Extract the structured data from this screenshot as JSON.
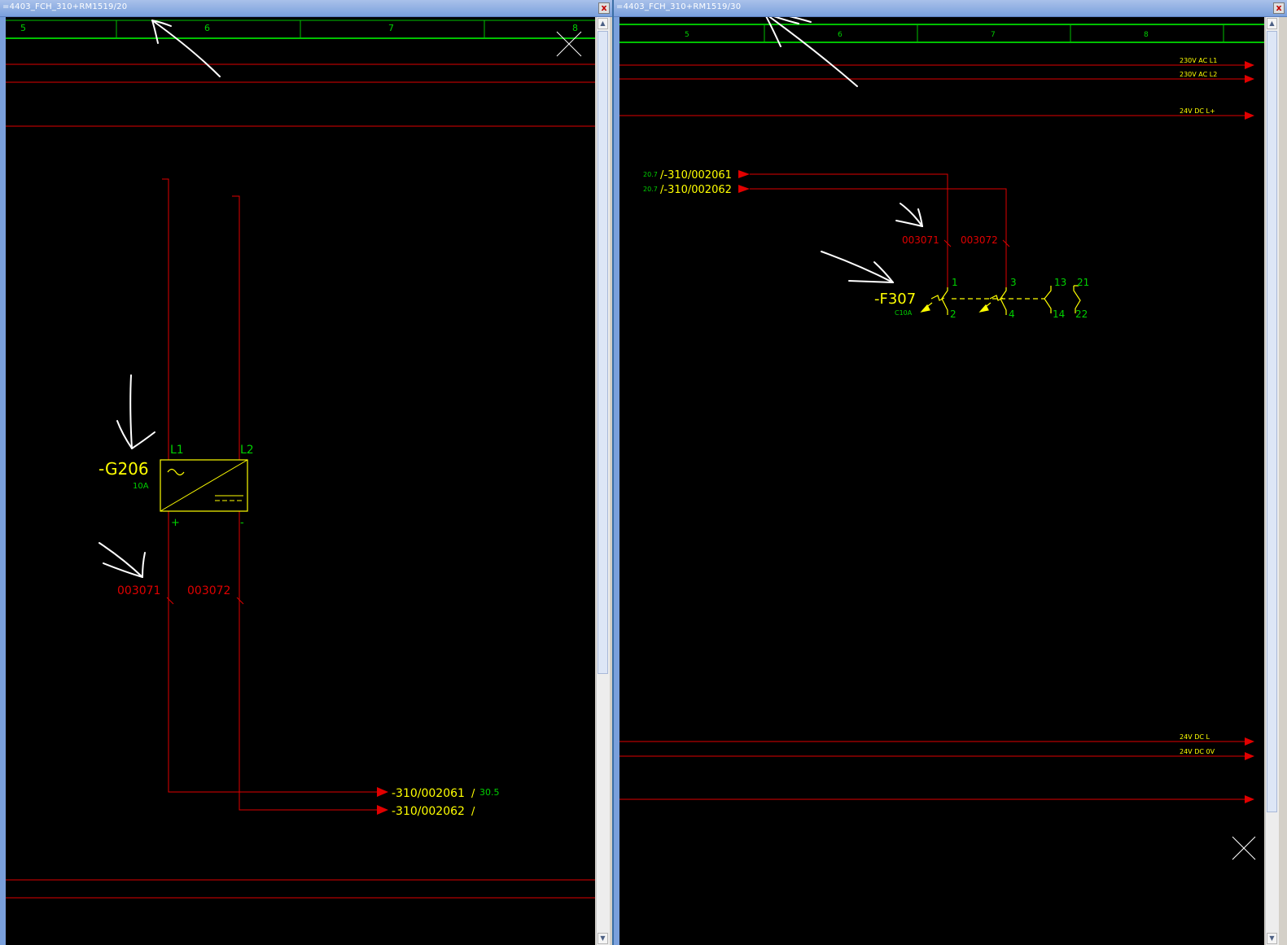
{
  "left_window": {
    "title": "=4403_FCH_310+RM1519/20",
    "close_glyph": "x",
    "columns": [
      "5",
      "6",
      "7",
      "8"
    ],
    "device": {
      "tag": "-G206",
      "rating": "10A",
      "term_l1": "L1",
      "term_l2": "L2",
      "term_plus": "+",
      "term_minus": "-"
    },
    "wires": [
      "003071",
      "003072"
    ],
    "xrefs": [
      {
        "target": "-310/002061",
        "page": "/",
        "col": "30.5"
      },
      {
        "target": "-310/002062",
        "page": "/",
        "col": ""
      }
    ]
  },
  "right_window": {
    "title": "=4403_FCH_310+RM1519/30",
    "close_glyph": "x",
    "columns": [
      "5",
      "6",
      "7",
      "8"
    ],
    "rails": [
      "230V AC L1",
      "230V AC L2",
      "24V DC L+",
      "24V DC L",
      "24V DC 0V"
    ],
    "xrefs": [
      {
        "col": "20.7",
        "target": "/-310/002061"
      },
      {
        "col": "20.7",
        "target": "/-310/002062"
      }
    ],
    "wires": [
      "003071",
      "003072"
    ],
    "device": {
      "tag": "-F307",
      "rating": "C10A",
      "terminals": [
        "1",
        "2",
        "3",
        "4",
        "13",
        "14",
        "21",
        "22"
      ]
    }
  },
  "colors": {
    "wire": "#e00000",
    "label": "#00d000",
    "device": "#ffff00",
    "grid": "#00c000",
    "canvas": "#000000"
  },
  "icons": [
    "close-icon",
    "scroll-up-arrow-icon",
    "scroll-down-arrow-icon",
    "cross-marker-icon"
  ]
}
